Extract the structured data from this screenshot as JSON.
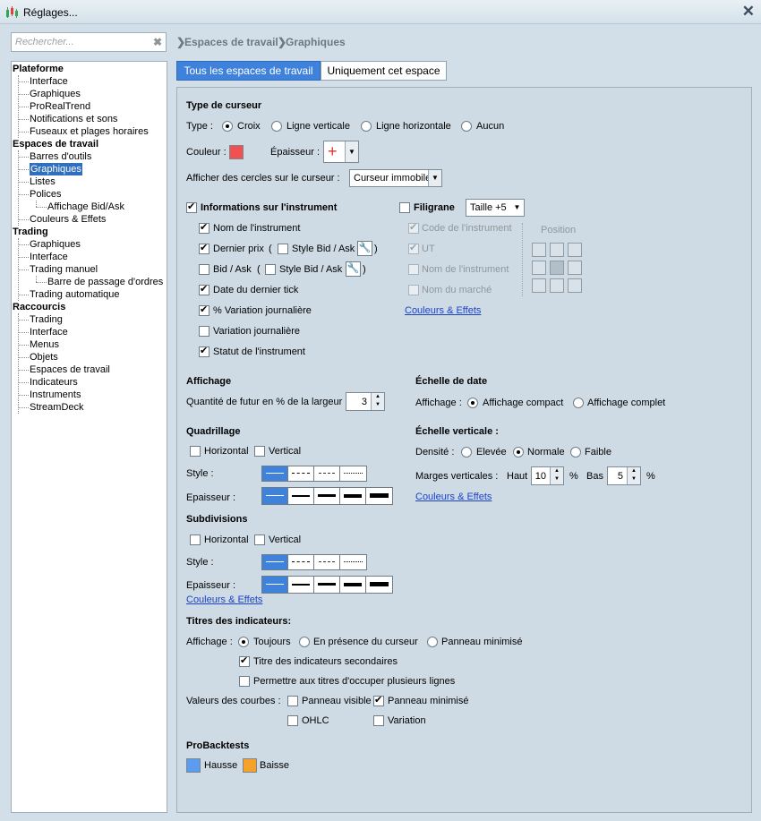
{
  "window": {
    "title": "Réglages..."
  },
  "search": {
    "placeholder": "Rechercher..."
  },
  "breadcrumb": {
    "part1": "Espaces de travail",
    "part2": "Graphiques"
  },
  "tree": {
    "groups": [
      {
        "label": "Plateforme",
        "items": [
          "Interface",
          "Graphiques",
          "ProRealTrend",
          "Notifications et sons",
          "Fuseaux et plages horaires"
        ]
      },
      {
        "label": "Espaces de travail",
        "items": [
          "Barres d'outils",
          "Graphiques",
          "Listes",
          "Polices",
          "Affichage Bid/Ask",
          "Couleurs & Effets"
        ]
      },
      {
        "label": "Trading",
        "items": [
          "Graphiques",
          "Interface",
          "Trading manuel",
          "Barre de passage d'ordres",
          "Trading automatique"
        ]
      },
      {
        "label": "Raccourcis",
        "items": [
          "Trading",
          "Interface",
          "Menus",
          "Objets",
          "Espaces de travail",
          "Indicateurs",
          "Instruments",
          "StreamDeck"
        ]
      }
    ]
  },
  "tabs": {
    "all": "Tous les espaces de travail",
    "this": "Uniquement cet espace"
  },
  "cursor": {
    "heading": "Type de curseur",
    "type_label": "Type :",
    "types": [
      "Croix",
      "Ligne verticale",
      "Ligne horizontale",
      "Aucun"
    ],
    "color_label": "Couleur :",
    "color": "#f05050",
    "thickness_label": "Épaisseur :",
    "thickness_icon": "+",
    "circles_label": "Afficher des cercles sur le curseur :",
    "circles_value": "Curseur immobile"
  },
  "info": {
    "heading": "Informations sur l'instrument",
    "name": "Nom de l'instrument",
    "last_price": "Dernier prix",
    "style_bid_ask": "Style Bid / Ask",
    "bid_ask": "Bid / Ask",
    "open_paren": "(",
    "close_paren": ")",
    "last_tick": "Date du dernier tick",
    "pct_change": "% Variation journalière",
    "daily_change": "Variation journalière",
    "status": "Statut de l'instrument"
  },
  "watermark": {
    "heading": "Filigrane",
    "size": "Taille +5",
    "code": "Code de l'instrument",
    "ut": "UT",
    "name": "Nom de l'instrument",
    "market": "Nom du marché",
    "position_label": "Position",
    "link": "Couleurs & Effets"
  },
  "display": {
    "heading": "Affichage",
    "future_label": "Quantité de futur en % de la largeur",
    "future_value": "3"
  },
  "date_scale": {
    "heading": "Échelle de date",
    "label": "Affichage :",
    "compact": "Affichage compact",
    "full": "Affichage complet"
  },
  "grid": {
    "heading": "Quadrillage",
    "horizontal": "Horizontal",
    "vertical": "Vertical",
    "style_label": "Style :",
    "thickness_label": "Epaisseur :"
  },
  "vscale": {
    "heading": "Échelle verticale :",
    "density_label": "Densité :",
    "high": "Elevée",
    "normal": "Normale",
    "low": "Faible",
    "margins_label": "Marges verticales :",
    "top_label": "Haut",
    "top_value": "10",
    "pct": "%",
    "bottom_label": "Bas",
    "bottom_value": "5",
    "link": "Couleurs & Effets"
  },
  "subdiv": {
    "heading": "Subdivisions",
    "horizontal": "Horizontal",
    "vertical": "Vertical",
    "style_label": "Style :",
    "thickness_label": "Epaisseur :",
    "link": "Couleurs & Effets"
  },
  "indicators": {
    "heading": "Titres des indicateurs:",
    "display_label": "Affichage :",
    "always": "Toujours",
    "cursor": "En présence du curseur",
    "minimized": "Panneau minimisé",
    "secondary": "Titre des indicateurs secondaires",
    "multiline": "Permettre aux titres d'occuper plusieurs lignes",
    "values_label": "Valeurs des courbes :",
    "visible_panel": "Panneau visible",
    "min_panel": "Panneau minimisé",
    "ohlc": "OHLC",
    "variation": "Variation"
  },
  "probacktests": {
    "heading": "ProBacktests",
    "up": "Hausse",
    "down": "Baisse",
    "up_color": "#5b9cf0",
    "down_color": "#f5a22a"
  }
}
